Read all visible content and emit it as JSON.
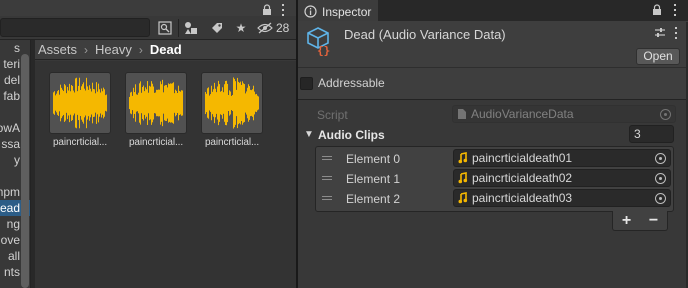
{
  "project": {
    "hidden_count": "28",
    "tree_items": [
      "s",
      "teri",
      "del",
      "fab",
      "",
      "owA",
      "ssa",
      "y",
      "",
      "mpm",
      "ead",
      "ng",
      "ove",
      "all",
      "nts"
    ],
    "tree_selected_index": 10,
    "breadcrumb": [
      "Assets",
      "Heavy",
      "Dead"
    ],
    "assets": [
      {
        "name": "paincrticial...",
        "icon": "audio-waveform-icon"
      },
      {
        "name": "paincrticial...",
        "icon": "audio-waveform-icon"
      },
      {
        "name": "paincrticial...",
        "icon": "audio-waveform-icon"
      }
    ]
  },
  "inspector": {
    "tab_label": "Inspector",
    "asset_title": "Dead (Audio Variance Data)",
    "open_label": "Open",
    "addressable_label": "Addressable",
    "addressable_checked": false,
    "script_label": "Script",
    "script_value": "AudioVarianceData",
    "list_label": "Audio Clips",
    "list_size": "3",
    "elements": [
      {
        "label": "Element 0",
        "value": "paincrticialdeath01"
      },
      {
        "label": "Element 1",
        "value": "paincrticialdeath02"
      },
      {
        "label": "Element 2",
        "value": "paincrticialdeath03"
      }
    ],
    "add_label": "+",
    "remove_label": "−"
  },
  "colors": {
    "waveform": "#f5b800",
    "selection": "#2c5d87",
    "audio_icon": "#f5b800",
    "script_icon_bracket": "#e8643c",
    "script_icon_cube": "#5fb4e8"
  }
}
